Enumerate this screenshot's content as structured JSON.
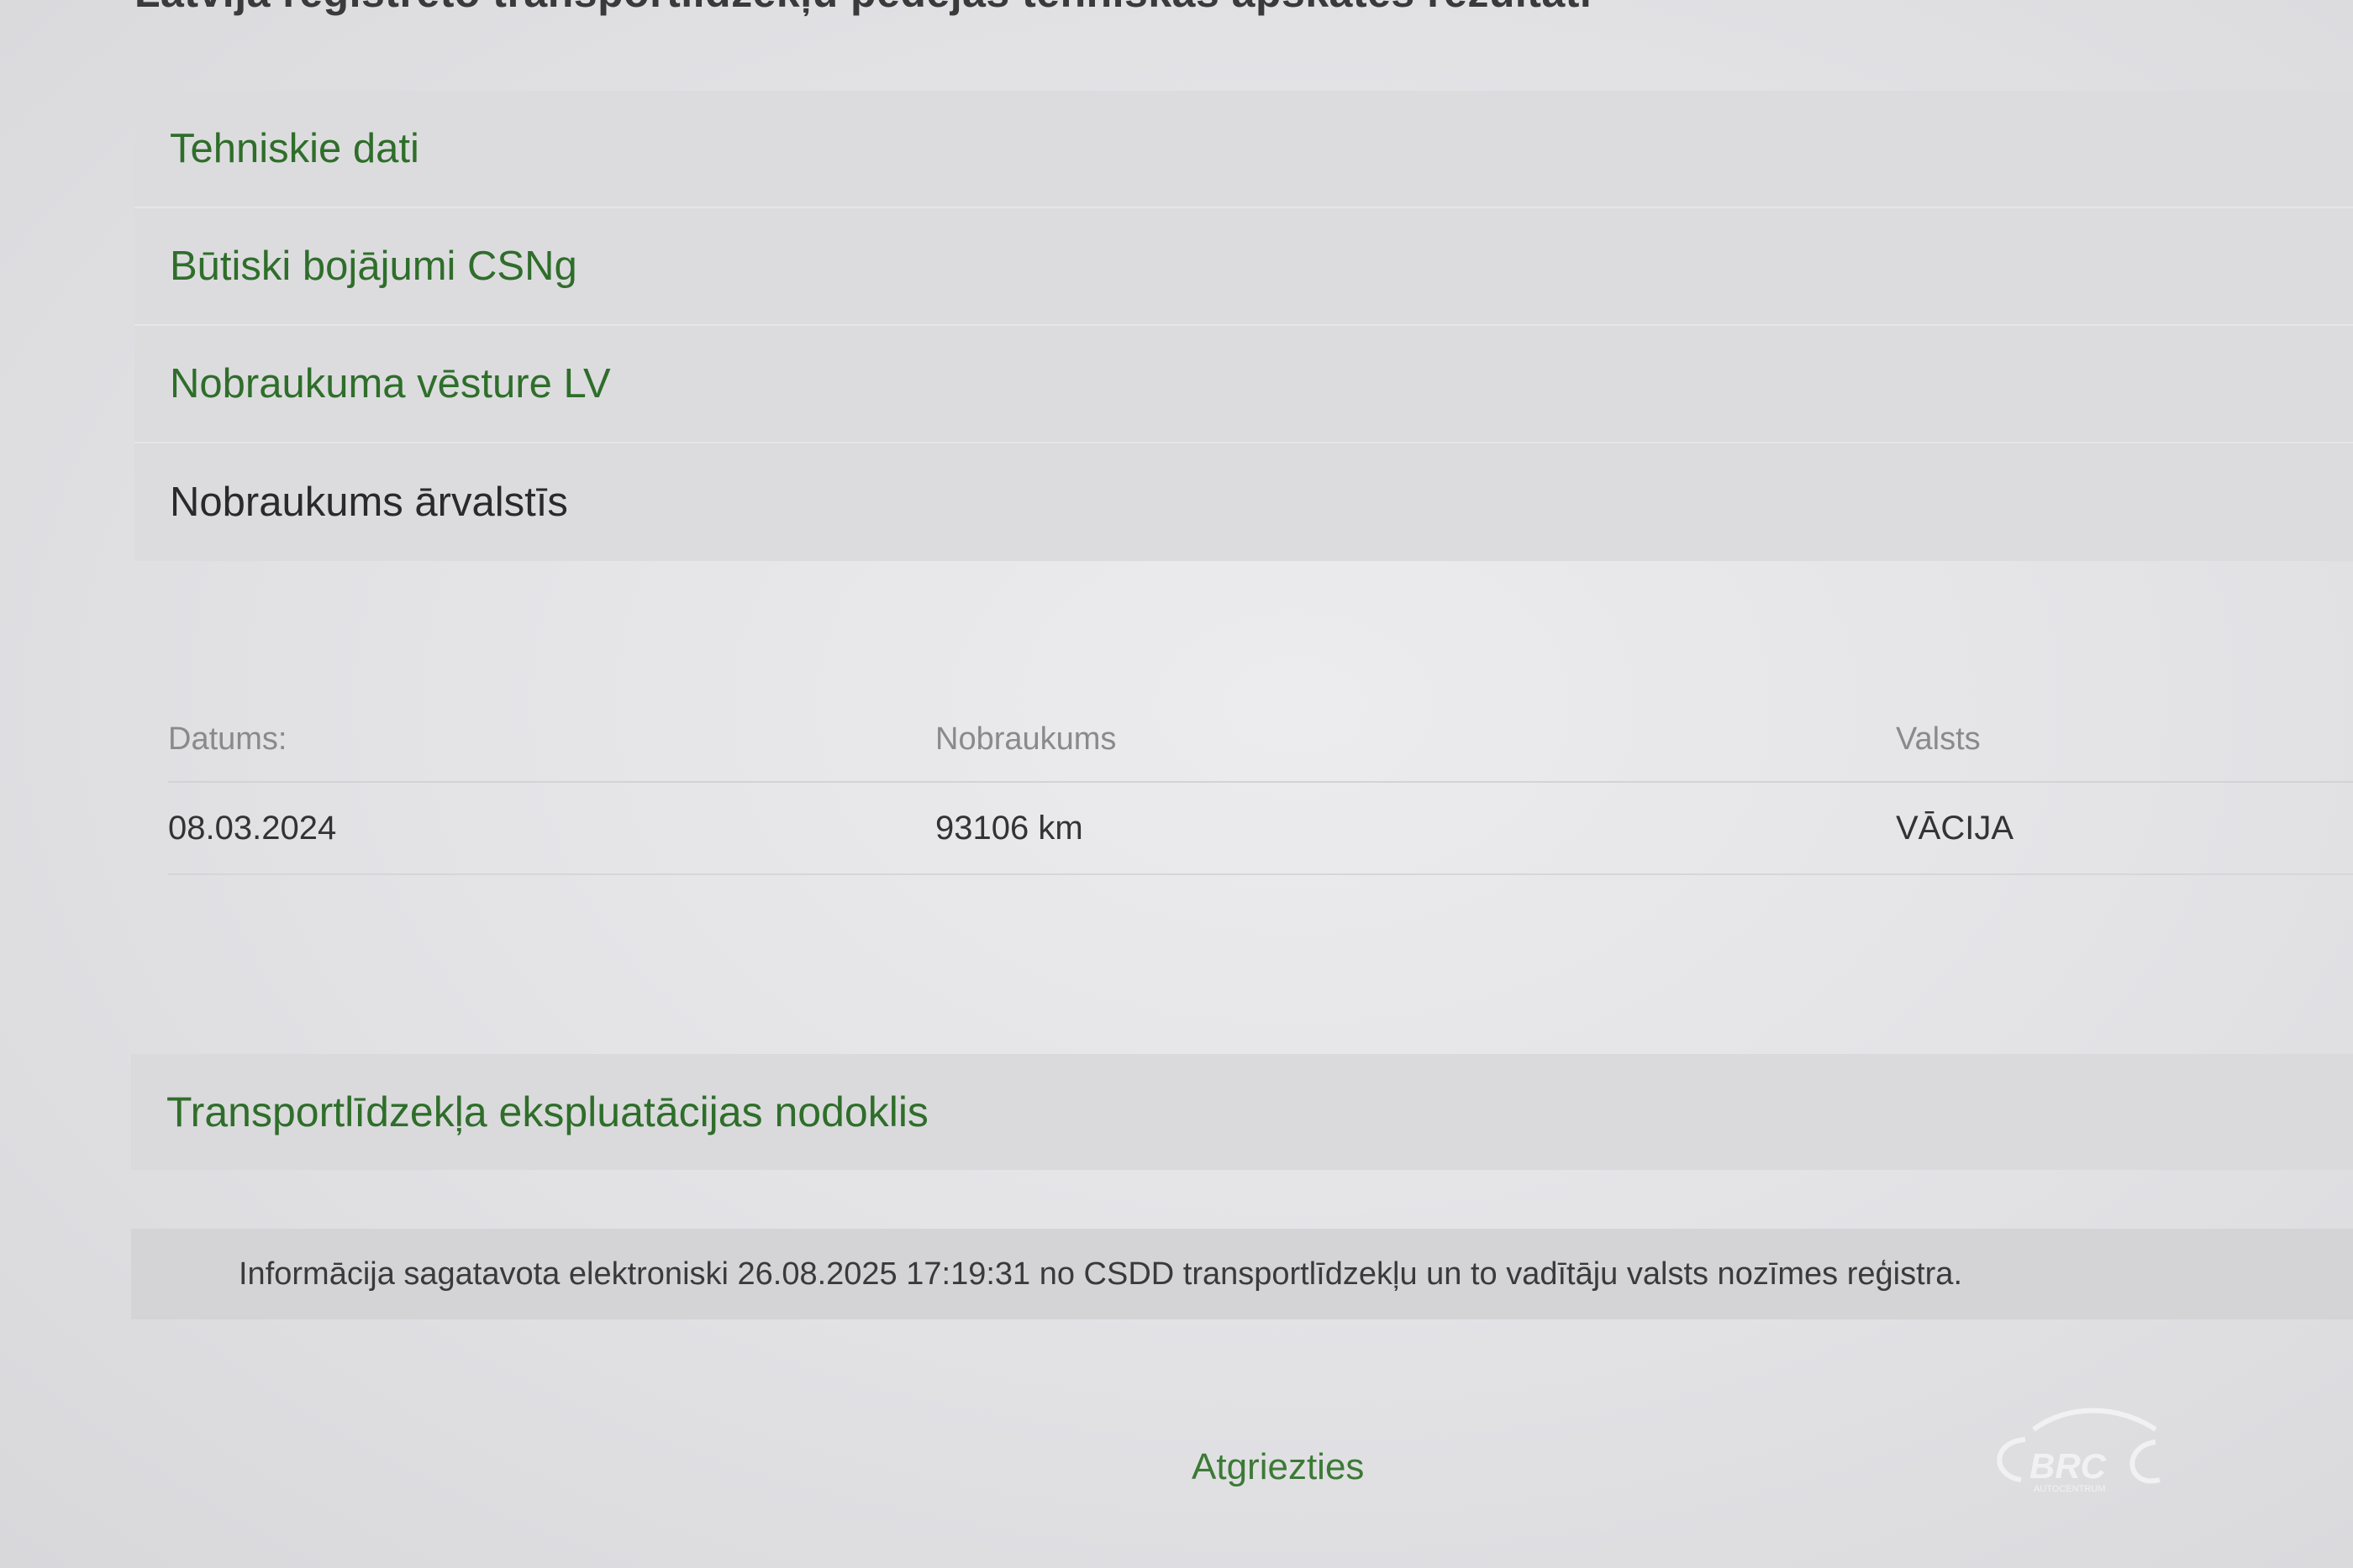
{
  "page_title": "Latvijā reģistrēto transportlīdzekļu pēdējās tehniskās apskates rezultāti",
  "accordion": {
    "items": [
      {
        "label": "Tehniskie dati",
        "active": false
      },
      {
        "label": "Būtiski bojājumi CSNg",
        "active": false
      },
      {
        "label": "Nobraukuma vēsture LV",
        "active": false
      },
      {
        "label": "Nobraukums ārvalstīs",
        "active": true
      }
    ]
  },
  "mileage_table": {
    "headers": [
      "Datums:",
      "Nobraukums",
      "Valsts"
    ],
    "rows": [
      [
        "08.03.2024",
        "93106 km",
        "VĀCIJA"
      ]
    ]
  },
  "tax_section": {
    "label": "Transportlīdzekļa ekspluatācijas nodoklis"
  },
  "info": {
    "text": "Informācija sagatavota elektroniski 26.08.2025 17:19:31 no CSDD transportlīdzekļu un to vadītāju valsts nozīmes reģistra."
  },
  "back_link": {
    "label": "Atgriezties"
  },
  "watermark": {
    "text": "BRC",
    "subtext": "AUTOCENTRUM"
  },
  "colors": {
    "accent_green": "#2f6e2a",
    "link_green": "#3c7a36",
    "background": "#e4e4e7"
  }
}
